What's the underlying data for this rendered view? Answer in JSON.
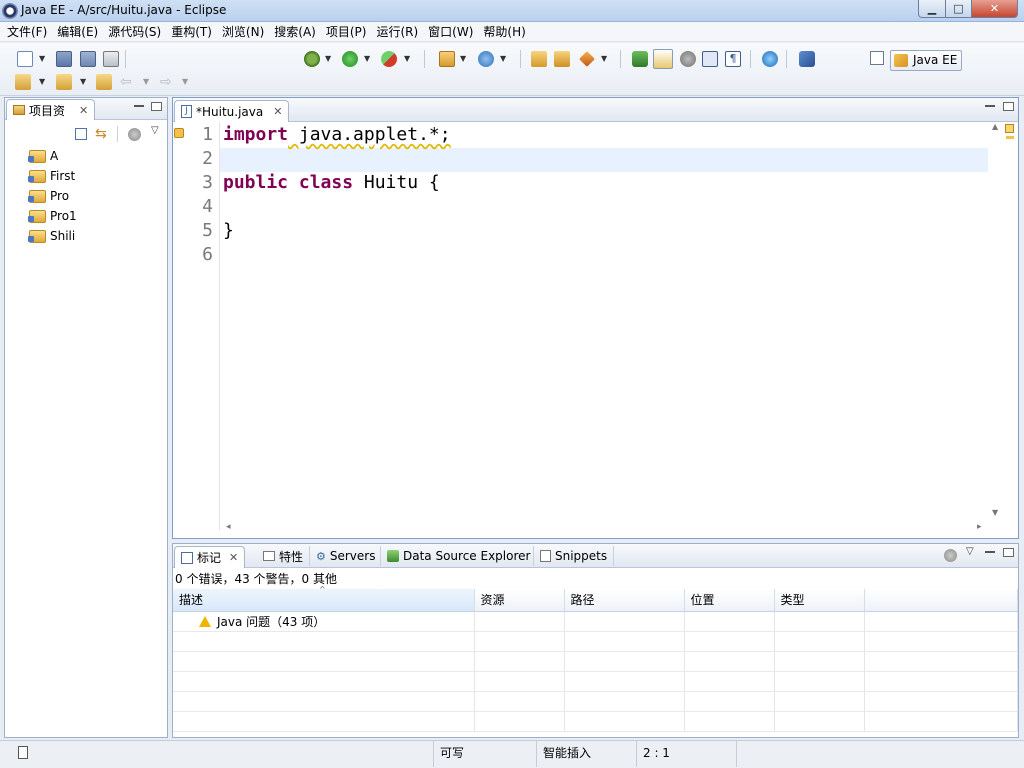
{
  "window": {
    "title": "Java EE - A/src/Huitu.java - Eclipse",
    "min_label": "▁",
    "max_label": "□",
    "close_label": "✕"
  },
  "menu": [
    "文件(F)",
    "编辑(E)",
    "源代码(S)",
    "重构(T)",
    "浏览(N)",
    "搜索(A)",
    "项目(P)",
    "运行(R)",
    "窗口(W)",
    "帮助(H)"
  ],
  "toolbar": {
    "perspective_label": "Java EE",
    "icons": [
      "new-icon",
      "save-icon",
      "save-all-icon",
      "print-icon",
      "debug-icon",
      "run-icon",
      "external-tools-icon",
      "new-java-project-icon",
      "new-class-icon",
      "open-type-icon",
      "open-resource-icon",
      "search-icon",
      "toggle-mark-icon",
      "highlight-icon",
      "show-whitespace-icon",
      "web-browser-icon",
      "next-annotation-icon",
      "prev-annotation-icon",
      "last-edit-icon",
      "back-icon",
      "forward-icon"
    ]
  },
  "project_explorer": {
    "tab_label": "项目资",
    "projects": [
      "A",
      "First",
      "Pro",
      "Pro1",
      "Shili"
    ]
  },
  "editor": {
    "tab_label": "*Huitu.java",
    "line_numbers": [
      "1",
      "2",
      "3",
      "4",
      "5",
      "6"
    ],
    "lines": [
      {
        "kw": "import",
        "rest": " java.applet.*;"
      },
      {
        "kw": "",
        "rest": ""
      },
      {
        "kw": "public class",
        "rest": " Huitu {"
      },
      {
        "kw": "",
        "rest": ""
      },
      {
        "kw": "",
        "rest": "}"
      },
      {
        "kw": "",
        "rest": ""
      }
    ]
  },
  "bottom_panel": {
    "tabs": [
      "标记",
      "特性",
      "Servers",
      "Data Source Explorer",
      "Snippets"
    ],
    "summary": "0 个错误，43 个警告，0 其他",
    "columns": [
      "描述",
      "资源",
      "路径",
      "位置",
      "类型"
    ],
    "rows": [
      {
        "description": "Java 问题（43 项）"
      }
    ]
  },
  "status": {
    "writable": "可写",
    "insert_mode": "智能插入",
    "position": "2 : 1"
  }
}
